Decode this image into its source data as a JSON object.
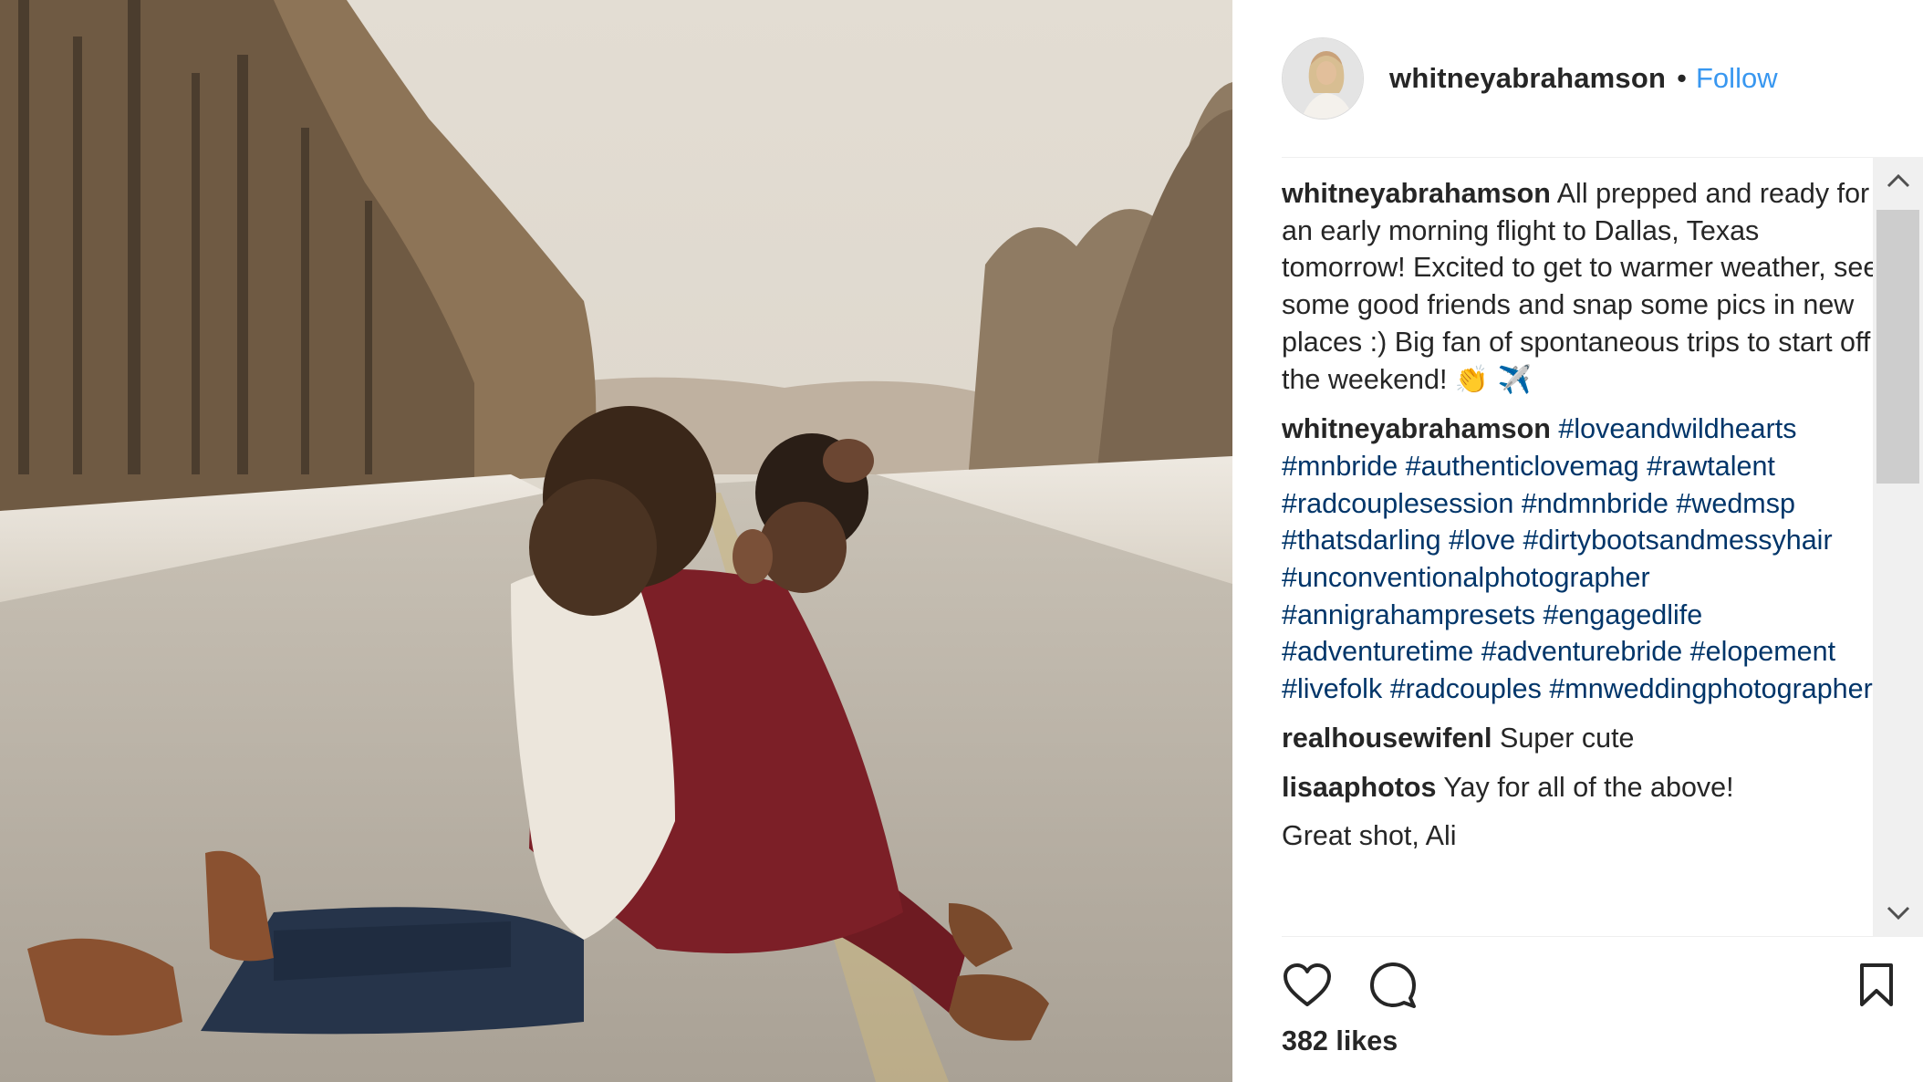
{
  "post": {
    "username": "whitneyabrahamson",
    "separator": "•",
    "follow_label": "Follow",
    "likes_label": "382 likes"
  },
  "comments": [
    {
      "user": "whitneyabrahamson",
      "text": "All prepped and ready for an early morning flight to Dallas, Texas tomorrow! Excited to get to warmer weather, see some good friends and snap some pics in new places :) Big fan of spontaneous trips to start off the weekend!",
      "emoji": "👏 ✈️"
    },
    {
      "user": "whitneyabrahamson",
      "hashtags": [
        "#loveandwildhearts",
        "#mnbride",
        "#authenticlovemag",
        "#rawtalent",
        "#radcouplesession",
        "#ndmnbride",
        "#wedmsp",
        "#thatsdarling",
        "#love",
        "#dirtybootsandmessyhair",
        "#unconventionalphotographer",
        "#annigrahampresets",
        "#engagedlife",
        "#adventuretime",
        "#adventurebride",
        "#elopement",
        "#livefolk",
        "#radcouples",
        "#mnweddingphotographer"
      ]
    },
    {
      "user": "realhousewifenl",
      "text": "Super cute"
    },
    {
      "user": "lisaaphotos",
      "text": "Yay for all of the above!"
    },
    {
      "user": "",
      "text": "Great shot, Ali"
    }
  ],
  "icons": {
    "like": "heart-outline-icon",
    "comment": "speech-bubble-icon",
    "save": "bookmark-icon",
    "scroll_up": "chevron-up-icon",
    "scroll_down": "chevron-down-icon"
  },
  "colors": {
    "link_blue": "#3897f0",
    "hashtag": "#003569",
    "text": "#262626"
  }
}
